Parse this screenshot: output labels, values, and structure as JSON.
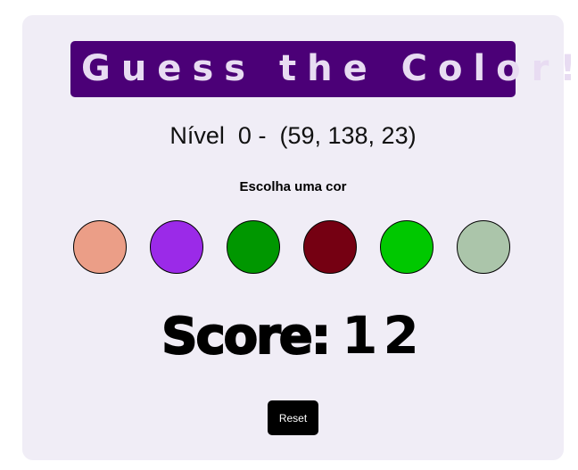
{
  "title": "Guess the Color!",
  "level": {
    "label": "Nível",
    "number": "0",
    "separator": "-",
    "rgb_text": "(59, 138, 23)"
  },
  "instruction": "Escolha uma cor",
  "swatches": [
    {
      "color": "#eb9e87"
    },
    {
      "color": "#9b2ae8"
    },
    {
      "color": "#009700"
    },
    {
      "color": "#750012"
    },
    {
      "color": "#00c800"
    },
    {
      "color": "#abc5aa"
    }
  ],
  "score": {
    "label": "Score:",
    "value": "12"
  },
  "reset_label": "Reset",
  "colors": {
    "title_bg": "#4b0077",
    "title_text": "#e8dcf2",
    "card_bg": "#f0edf6",
    "button_bg": "#000000"
  }
}
